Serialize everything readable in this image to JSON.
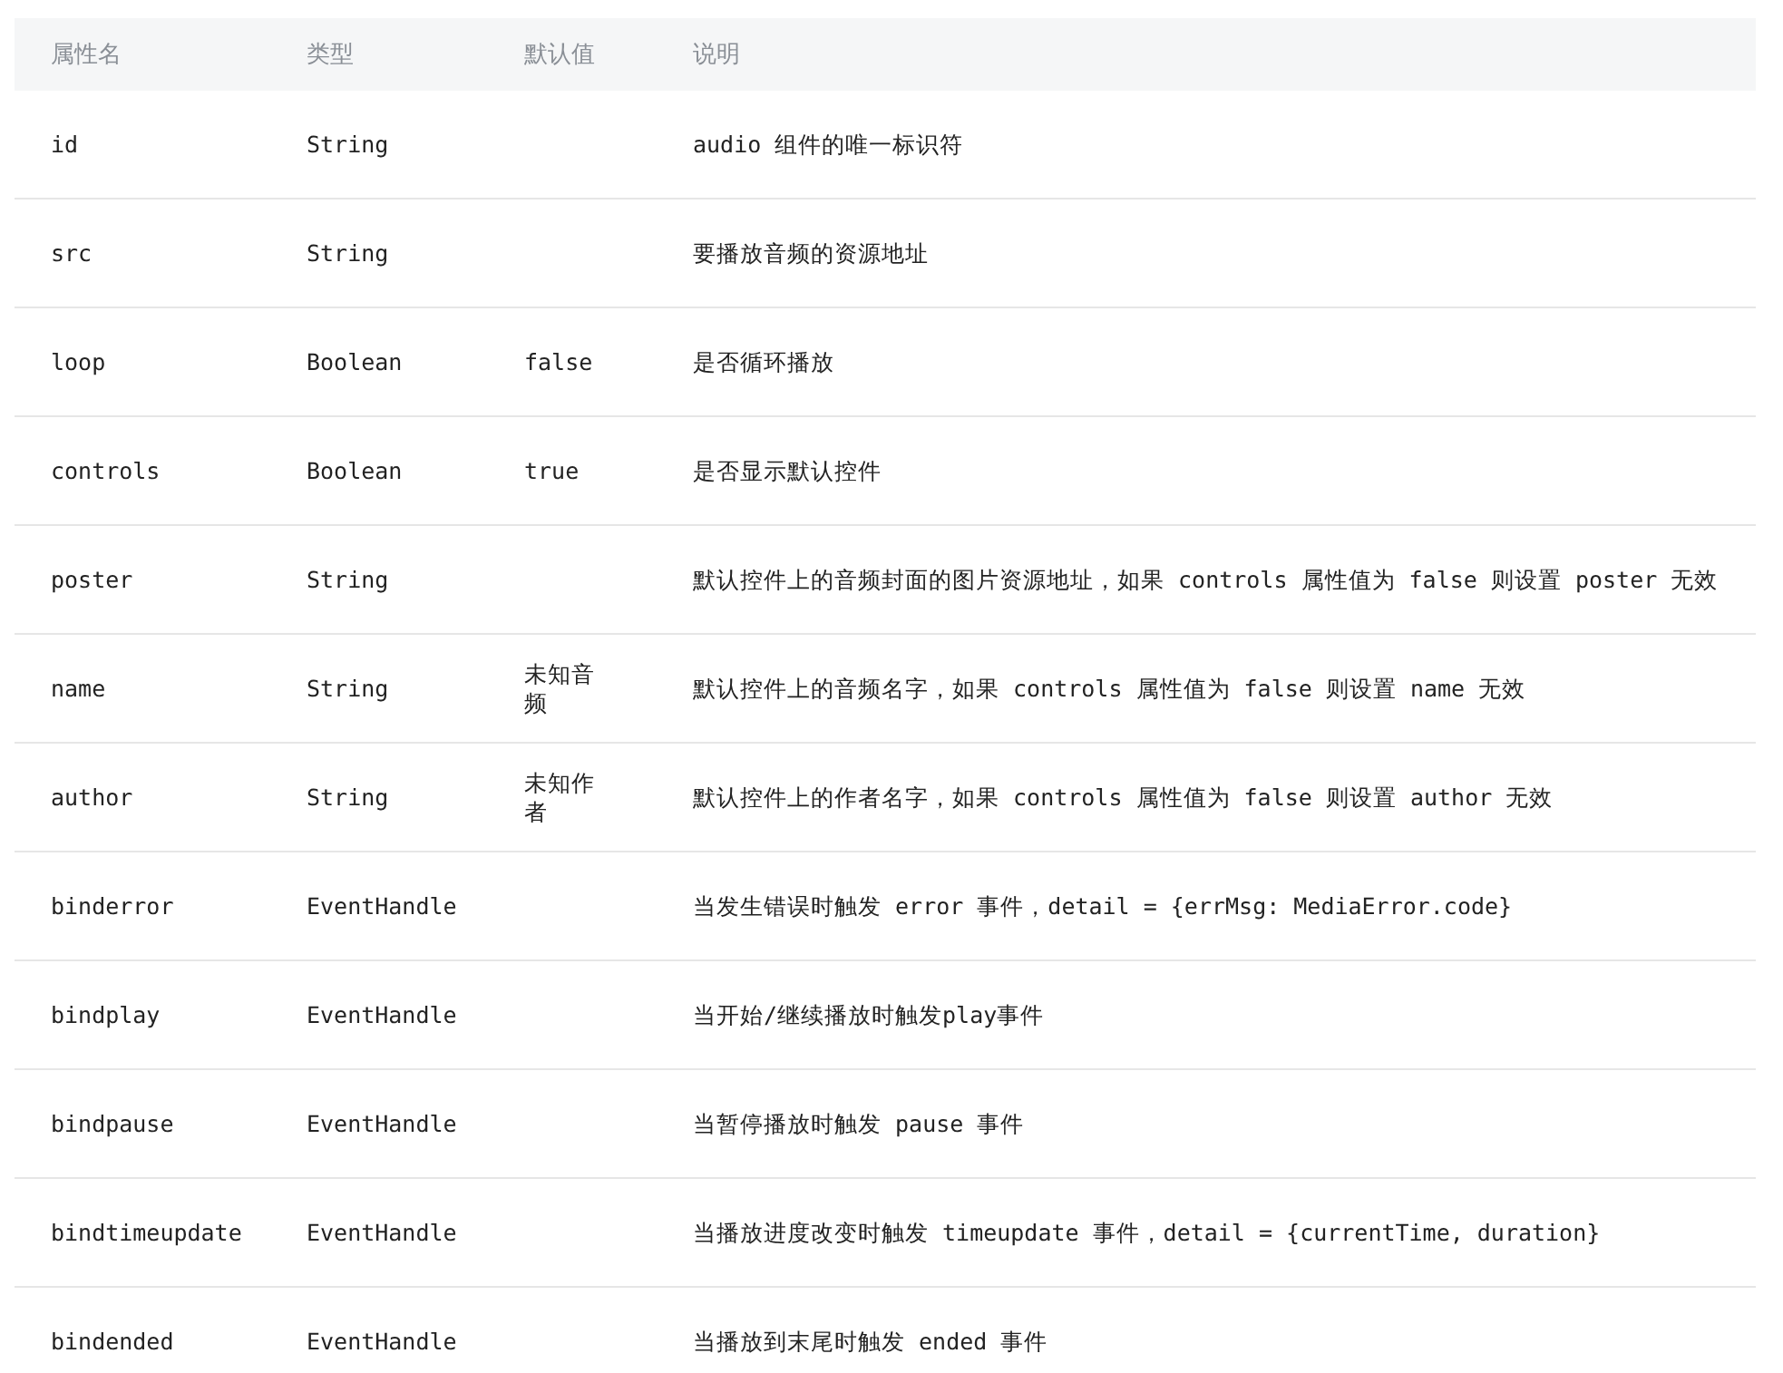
{
  "table": {
    "columns": [
      "属性名",
      "类型",
      "默认值",
      "说明"
    ],
    "rows": [
      {
        "name": "id",
        "type": "String",
        "default": "",
        "description": "audio 组件的唯一标识符"
      },
      {
        "name": "src",
        "type": "String",
        "default": "",
        "description": "要播放音频的资源地址"
      },
      {
        "name": "loop",
        "type": "Boolean",
        "default": "false",
        "description": "是否循环播放"
      },
      {
        "name": "controls",
        "type": "Boolean",
        "default": "true",
        "description": "是否显示默认控件"
      },
      {
        "name": "poster",
        "type": "String",
        "default": "",
        "description": "默认控件上的音频封面的图片资源地址，如果 controls 属性值为 false 则设置 poster 无效"
      },
      {
        "name": "name",
        "type": "String",
        "default": "未知音频",
        "description": "默认控件上的音频名字，如果 controls 属性值为 false 则设置 name 无效"
      },
      {
        "name": "author",
        "type": "String",
        "default": "未知作者",
        "description": "默认控件上的作者名字，如果 controls 属性值为 false 则设置 author 无效"
      },
      {
        "name": "binderror",
        "type": "EventHandle",
        "default": "",
        "description": "当发生错误时触发 error 事件，detail = {errMsg: MediaError.code}"
      },
      {
        "name": "bindplay",
        "type": "EventHandle",
        "default": "",
        "description": "当开始/继续播放时触发play事件"
      },
      {
        "name": "bindpause",
        "type": "EventHandle",
        "default": "",
        "description": "当暂停播放时触发 pause 事件"
      },
      {
        "name": "bindtimeupdate",
        "type": "EventHandle",
        "default": "",
        "description": "当播放进度改变时触发 timeupdate 事件，detail = {currentTime, duration}"
      },
      {
        "name": "bindended",
        "type": "EventHandle",
        "default": "",
        "description": "当播放到末尾时触发 ended 事件"
      }
    ]
  }
}
